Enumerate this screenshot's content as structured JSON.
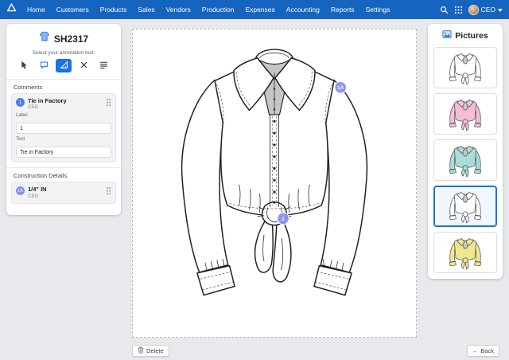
{
  "colors": {
    "accent": "#1565c0",
    "tool_active": "#1a73e8",
    "marker": "#8b8ff2",
    "comment_badge": "#4f7df9",
    "construction_badge": "#8b8ff2"
  },
  "navbar": {
    "items": [
      {
        "label": "Home"
      },
      {
        "label": "Customers"
      },
      {
        "label": "Products"
      },
      {
        "label": "Sales"
      },
      {
        "label": "Vendors"
      },
      {
        "label": "Production"
      },
      {
        "label": "Expenses"
      },
      {
        "label": "Accounting"
      },
      {
        "label": "Reports"
      },
      {
        "label": "Settings"
      }
    ],
    "user": "CEO"
  },
  "panel": {
    "title": "SH2317",
    "tool_prompt": "Select your annotation tool:",
    "tools": [
      {
        "name": "select"
      },
      {
        "name": "comment"
      },
      {
        "name": "measure",
        "active": true
      },
      {
        "name": "remove"
      },
      {
        "name": "details"
      }
    ],
    "comments": {
      "heading": "Comments",
      "items": [
        {
          "badge": "1",
          "title": "Tie in Factory",
          "author": "CEO"
        }
      ],
      "fields": [
        {
          "label": "Label",
          "value": "1"
        },
        {
          "label": "Text",
          "value": "Tie in Factory"
        }
      ]
    },
    "construction": {
      "heading": "Construction Details",
      "items": [
        {
          "badge": "1A",
          "title": "1/4\" IN",
          "author": "CEO"
        }
      ]
    }
  },
  "canvas": {
    "markers": [
      {
        "label": "1A"
      },
      {
        "label": "1"
      }
    ]
  },
  "pictures": {
    "heading": "Pictures",
    "items": [
      {
        "name": "sketch-white",
        "color": "#ffffff",
        "selected": false
      },
      {
        "name": "pink",
        "color": "#f5bed6",
        "selected": false
      },
      {
        "name": "teal",
        "color": "#abdcd8",
        "selected": false
      },
      {
        "name": "white",
        "color": "#ffffff",
        "selected": true
      },
      {
        "name": "yellow",
        "color": "#f1e88e",
        "selected": false
      }
    ]
  },
  "footer": {
    "delete_label": "Delete",
    "back_icon": "←",
    "back_label": "Back"
  }
}
